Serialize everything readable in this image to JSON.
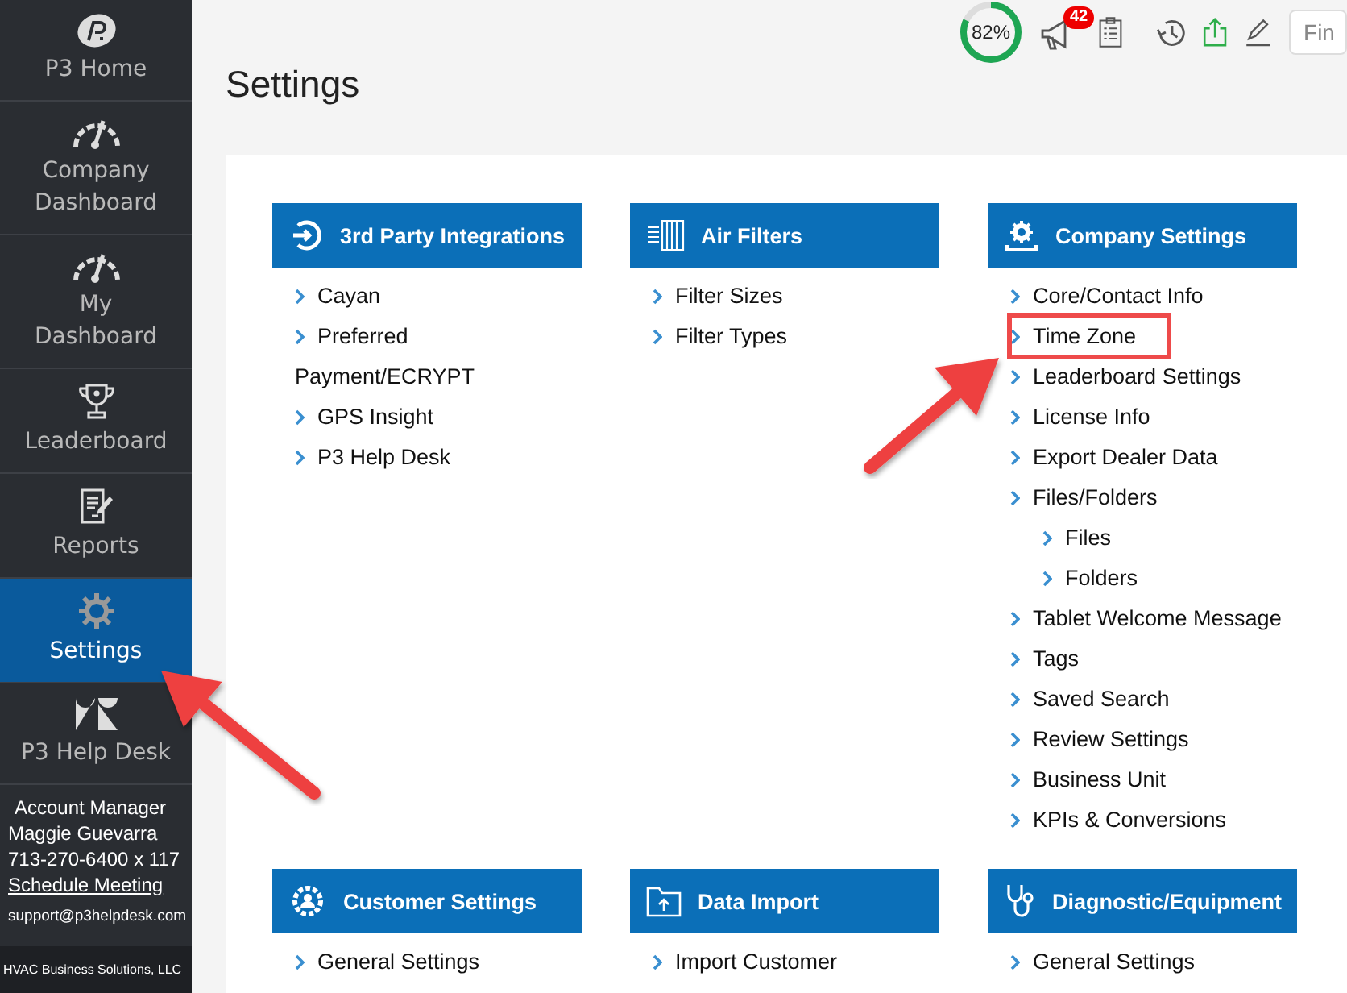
{
  "sidebar": {
    "nav": [
      {
        "label": "P3 Home",
        "selected": false
      },
      {
        "label": "Company Dashboard",
        "selected": false
      },
      {
        "label": "My Dashboard",
        "selected": false
      },
      {
        "label": "Leaderboard",
        "selected": false
      },
      {
        "label": "Reports",
        "selected": false
      },
      {
        "label": "Settings",
        "selected": true
      },
      {
        "label": "P3 Help Desk",
        "selected": false
      }
    ],
    "account": {
      "heading": "Account Manager",
      "name": "Maggie Guevarra",
      "phone": "713-270-6400 x 117",
      "link": "Schedule Meeting",
      "email": "support@p3helpdesk.com"
    },
    "footer": "HVAC Business Solutions, LLC"
  },
  "toolbar": {
    "progress": {
      "level": 0.82,
      "reading": "82%"
    },
    "badge": "42",
    "search": {
      "placeholder": "Fin"
    }
  },
  "page_title": "Settings",
  "cards": [
    {
      "title": "3rd Party Integrations",
      "items": [
        {
          "label": "Cayan",
          "highlighted": false
        },
        {
          "label": "Preferred Payment/ECRYPT",
          "highlighted": false
        },
        {
          "label": "GPS Insight",
          "highlighted": false
        },
        {
          "label": "P3 Help Desk",
          "highlighted": false
        }
      ]
    },
    {
      "title": "Air Filters",
      "items": [
        {
          "label": "Filter Sizes",
          "highlighted": false
        },
        {
          "label": "Filter Types",
          "highlighted": false
        }
      ]
    },
    {
      "title": "Company Settings",
      "items": [
        {
          "label": "Core/Contact Info",
          "highlighted": false
        },
        {
          "label": "Time Zone",
          "highlighted": true
        },
        {
          "label": "Leaderboard Settings",
          "highlighted": false
        },
        {
          "label": "License Info",
          "highlighted": false
        },
        {
          "label": "Export Dealer Data",
          "highlighted": false
        },
        {
          "label": "Files/Folders",
          "highlighted": false,
          "children": [
            {
              "label": "Files",
              "highlighted": false
            },
            {
              "label": "Folders",
              "highlighted": false
            }
          ]
        },
        {
          "label": "Tablet Welcome Message",
          "highlighted": false
        },
        {
          "label": "Tags",
          "highlighted": false
        },
        {
          "label": "Saved Search",
          "highlighted": false
        },
        {
          "label": "Review Settings",
          "highlighted": false
        },
        {
          "label": "Business Unit",
          "highlighted": false
        },
        {
          "label": "KPIs & Conversions",
          "highlighted": false
        }
      ]
    },
    {
      "title": "Customer Settings",
      "items": [
        {
          "label": "General Settings",
          "highlighted": false
        }
      ]
    },
    {
      "title": "Data Import",
      "items": [
        {
          "label": "Import Customer",
          "highlighted": false
        }
      ]
    },
    {
      "title": "Diagnostic/Equipment",
      "items": [
        {
          "label": "General Settings",
          "highlighted": false
        }
      ]
    }
  ]
}
